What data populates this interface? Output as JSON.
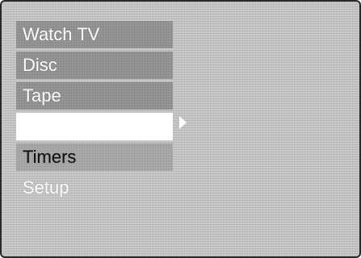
{
  "menu": {
    "items": [
      {
        "label": "Watch TV"
      },
      {
        "label": "Disc"
      },
      {
        "label": "Tape"
      },
      {
        "label": ""
      },
      {
        "label": "Timers"
      },
      {
        "label": "Setup"
      }
    ]
  },
  "icons": {
    "selection_arrow": "chevron-right-icon"
  },
  "colors": {
    "highlight": "#ffffff",
    "item_background": "#8f8f8f",
    "screen_background": "#cfcfcf"
  }
}
